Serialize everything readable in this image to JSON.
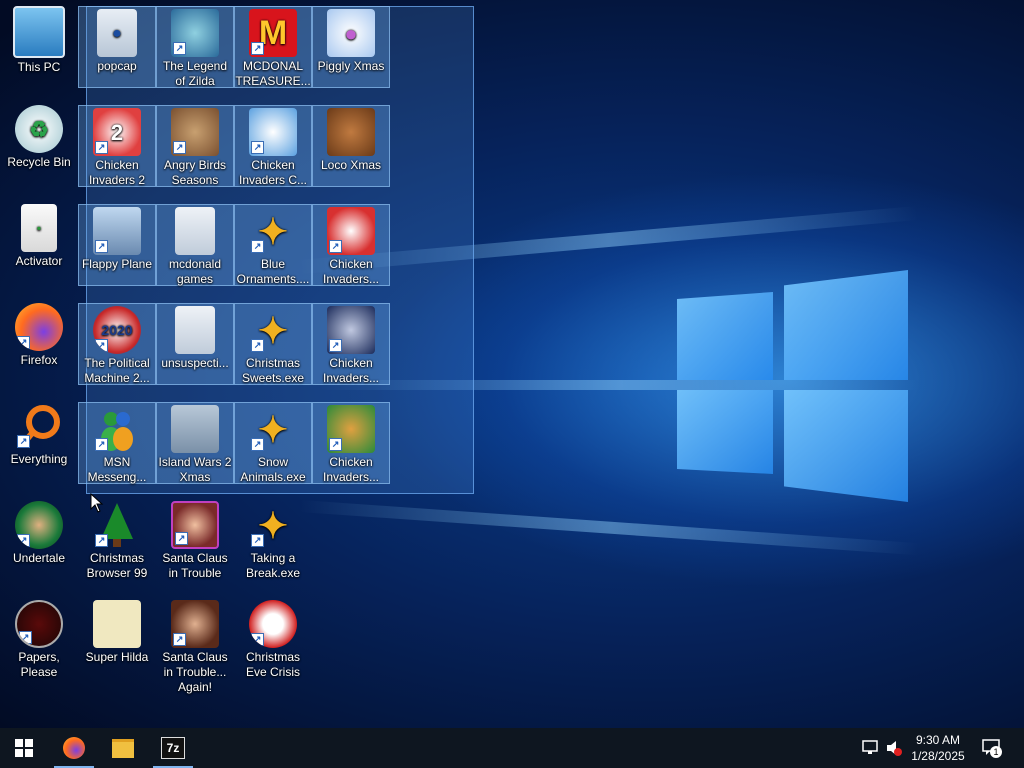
{
  "desktop": {
    "left_column": [
      {
        "name": "this-pc",
        "label": "This PC",
        "icon": "monitor-icon"
      },
      {
        "name": "recycle-bin",
        "label": "Recycle Bin",
        "icon": "recycle-bin-icon"
      },
      {
        "name": "activator",
        "label": "Activator",
        "icon": "file-icon"
      },
      {
        "name": "firefox",
        "label": "Firefox",
        "icon": "firefox-icon"
      },
      {
        "name": "everything",
        "label": "Everything",
        "icon": "magnifier-icon"
      },
      {
        "name": "undertale",
        "label": "Undertale",
        "icon": "undertale-icon"
      },
      {
        "name": "papers-please",
        "label": "Papers, Please",
        "icon": "papers-please-icon"
      }
    ],
    "selected_grid": [
      {
        "name": "popcap",
        "label": "popcap",
        "icon": "folder-icon"
      },
      {
        "name": "legend-of-zilda",
        "label": "The Legend of Zilda",
        "icon": "game-character-icon"
      },
      {
        "name": "mcdonald-treasure",
        "label": "MCDONAL TREASURE...",
        "icon": "mcdonalds-logo-icon"
      },
      {
        "name": "piggly-xmas",
        "label": "Piggly Xmas",
        "icon": "pig-icon"
      },
      {
        "name": "chicken-invaders-2",
        "label": "Chicken Invaders 2",
        "icon": "chicken-icon"
      },
      {
        "name": "angry-birds-seasons",
        "label": "Angry Birds Seasons",
        "icon": "angry-bird-icon"
      },
      {
        "name": "chicken-invaders-c",
        "label": "Chicken Invaders C...",
        "icon": "snowman-chicken-icon"
      },
      {
        "name": "loco-xmas",
        "label": "Loco Xmas",
        "icon": "teddy-bear-icon"
      },
      {
        "name": "flappy-plane",
        "label": "Flappy Plane",
        "icon": "plane-icon"
      },
      {
        "name": "mcdonald-games",
        "label": "mcdonald games",
        "icon": "folder-icon"
      },
      {
        "name": "blue-ornaments",
        "label": "Blue Ornaments....",
        "icon": "puzzle-icon"
      },
      {
        "name": "chicken-invaders-4",
        "label": "Chicken Invaders...",
        "icon": "santa-chicken-icon"
      },
      {
        "name": "political-machine",
        "label": "The Political Machine 2...",
        "icon": "badge-2020-icon"
      },
      {
        "name": "unsuspecting",
        "label": "unsuspecti...",
        "icon": "folder-icon"
      },
      {
        "name": "christmas-sweets",
        "label": "Christmas Sweets.exe",
        "icon": "puzzle-icon"
      },
      {
        "name": "chicken-invaders-5",
        "label": "Chicken Invaders...",
        "icon": "spaceship-icon"
      },
      {
        "name": "msn-messenger",
        "label": "MSN Messeng...",
        "icon": "msn-icon"
      },
      {
        "name": "island-wars-2",
        "label": "Island Wars 2 Xmas",
        "icon": "fighter-jet-icon"
      },
      {
        "name": "snow-animals",
        "label": "Snow Animals.exe",
        "icon": "puzzle-icon"
      },
      {
        "name": "chicken-invaders-6",
        "label": "Chicken Invaders...",
        "icon": "chicken-egg-icon"
      }
    ],
    "bottom_row_1": [
      {
        "name": "christmas-browser-99",
        "label": "Christmas Browser 99",
        "icon": "christmas-tree-icon"
      },
      {
        "name": "santa-claus-trouble",
        "label": "Santa Claus in Trouble",
        "icon": "santa-icon"
      },
      {
        "name": "taking-a-break",
        "label": "Taking a Break.exe",
        "icon": "puzzle-icon"
      }
    ],
    "bottom_row_2": [
      {
        "name": "super-hilda",
        "label": "Super Hilda",
        "icon": "pixel-dog-icon"
      },
      {
        "name": "santa-claus-trouble-again",
        "label": "Santa Claus in Trouble... Again!",
        "icon": "santa-icon"
      },
      {
        "name": "christmas-eve-crisis",
        "label": "Christmas Eve Crisis",
        "icon": "santa-face-icon"
      }
    ]
  },
  "taskbar": {
    "start_icon": "windows-logo-icon",
    "apps": [
      {
        "name": "firefox",
        "icon": "firefox-icon",
        "active": true
      },
      {
        "name": "file-explorer",
        "icon": "folder-icon",
        "active": false
      },
      {
        "name": "7zip",
        "icon": "7zip-icon",
        "label": "7z",
        "active": true
      }
    ],
    "time": "9:30 AM",
    "date": "1/28/2025",
    "notification_count": "1"
  },
  "colors": {
    "selection": "#5096e6",
    "taskbar": "#0e1620",
    "accent": "#7fb4ef"
  }
}
